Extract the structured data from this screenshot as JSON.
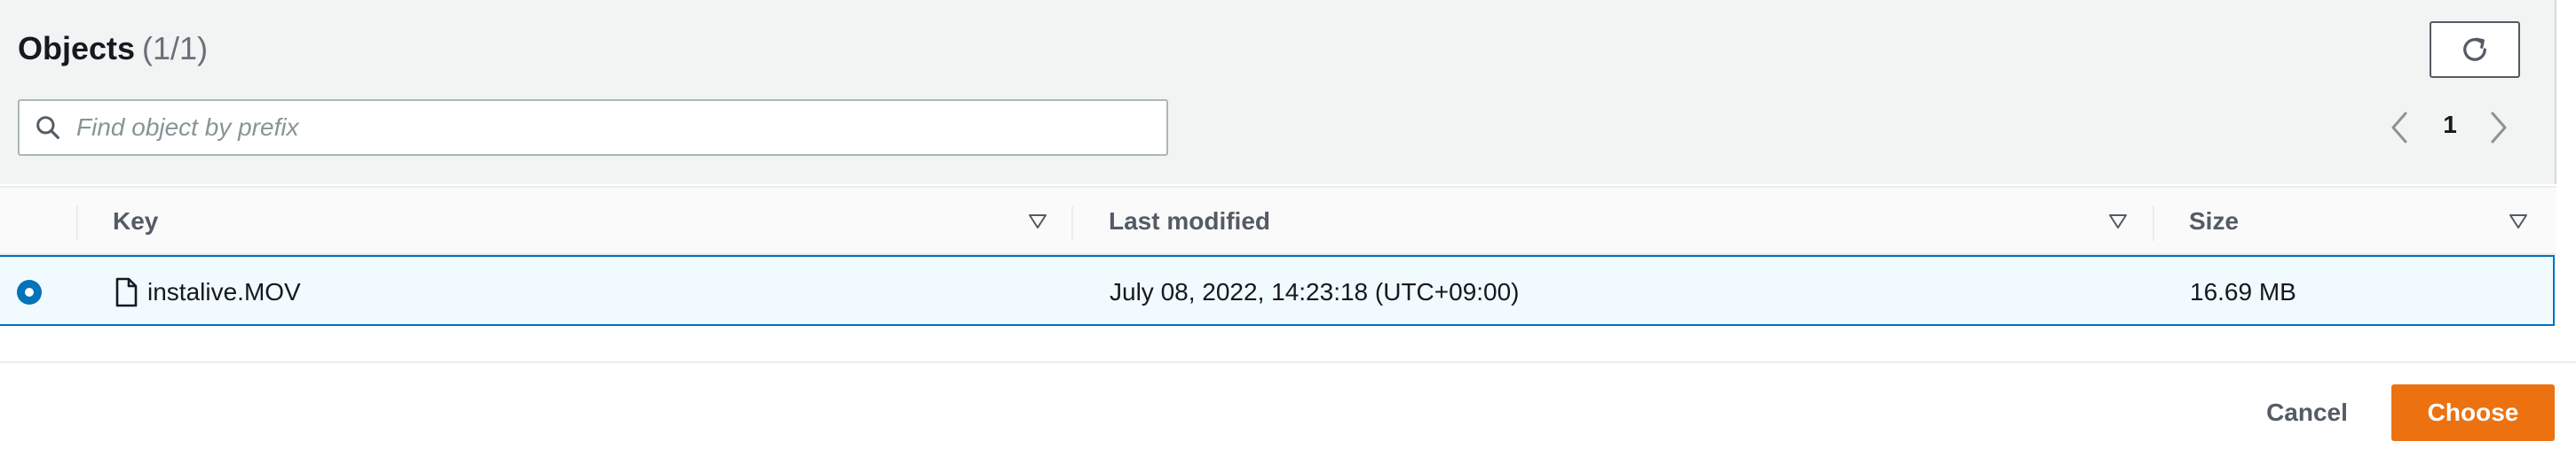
{
  "header": {
    "title": "Objects",
    "count": "(1/1)"
  },
  "toolbar": {
    "refresh_icon": "refresh-icon"
  },
  "search": {
    "placeholder": "Find object by prefix",
    "value": "",
    "icon": "search-icon"
  },
  "pagination": {
    "current_page": "1",
    "prev_icon": "chevron-left-icon",
    "next_icon": "chevron-right-icon"
  },
  "table": {
    "columns": [
      {
        "label": "Key"
      },
      {
        "label": "Last modified"
      },
      {
        "label": "Size"
      }
    ],
    "rows": [
      {
        "selected": true,
        "icon": "file-icon",
        "key": "instalive.MOV",
        "last_modified": "July 08, 2022, 14:23:18 (UTC+09:00)",
        "size": "16.69 MB"
      }
    ]
  },
  "footer": {
    "cancel_label": "Cancel",
    "choose_label": "Choose"
  },
  "colors": {
    "accent": "#0073bb",
    "primary_button": "#ec7211",
    "selected_row_bg": "#f1faff",
    "header_bg": "#f2f3f3"
  }
}
